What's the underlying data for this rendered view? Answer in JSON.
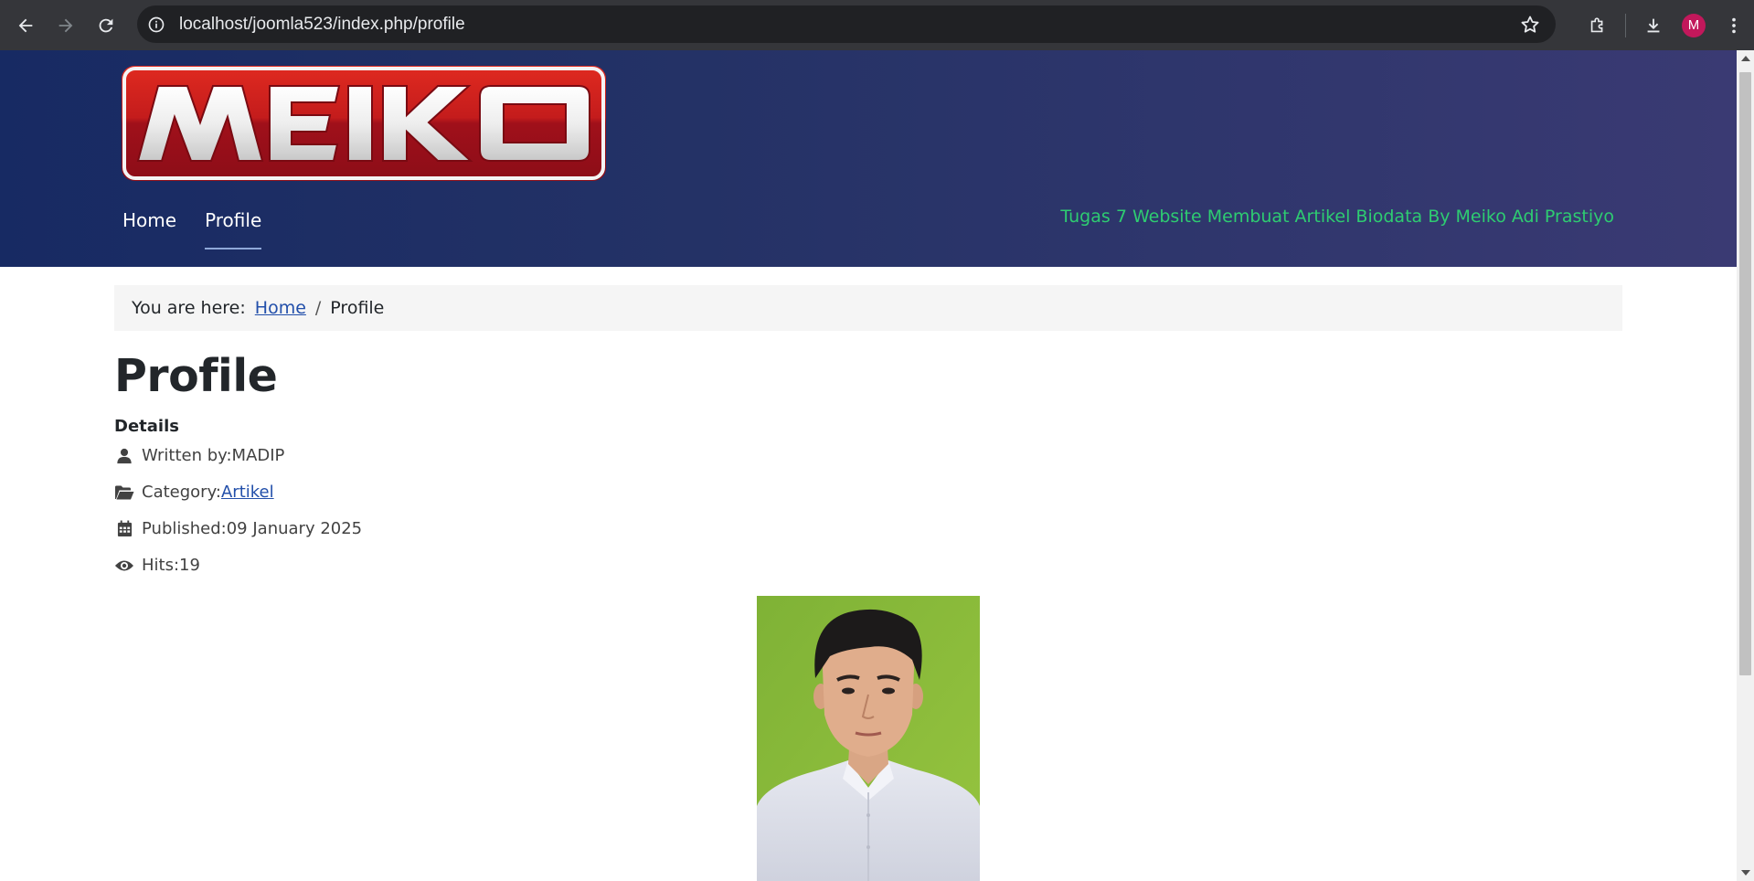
{
  "browser": {
    "url": "localhost/joomla523/index.php/profile",
    "avatar_letter": "M"
  },
  "site": {
    "logo_text": "MEIKO",
    "nav": [
      {
        "label": "Home"
      },
      {
        "label": "Profile"
      }
    ],
    "tagline": "Tugas 7 Website Membuat Artikel Biodata By Meiko Adi Prastiyo"
  },
  "breadcrumb": {
    "prefix": "You are here:",
    "home": "Home",
    "divider": "/",
    "current": "Profile"
  },
  "article": {
    "title": "Profile",
    "details_label": "Details",
    "written_by_label": "Written by: ",
    "author": "MADIP",
    "category_label": "Category: ",
    "category": "Artikel",
    "published_label": "Published: ",
    "published": "09 January 2025",
    "hits_label": "Hits: ",
    "hits": "19"
  },
  "colors": {
    "header_start": "#172a63",
    "header_end": "#3a3a73",
    "tagline": "#2ecc71",
    "link": "#224faa",
    "logo_red": "#b4121b"
  }
}
